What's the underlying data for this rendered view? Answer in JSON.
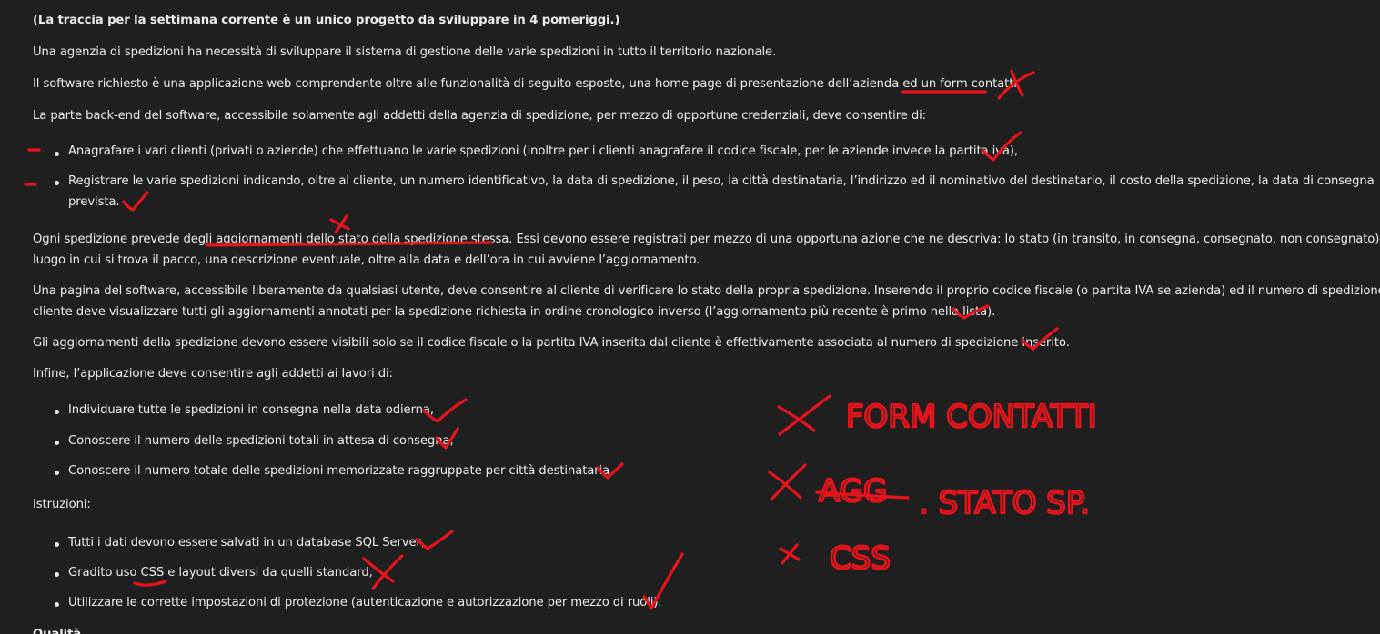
{
  "document": {
    "heading": "(La traccia per la settimana corrente è un unico progetto da sviluppare in 4 pomeriggi.)",
    "p1": "Una agenzia di spedizioni ha necessità di sviluppare il sistema di gestione delle varie spedizioni in tutto il territorio nazionale.",
    "p2": "Il software richiesto è una applicazione web comprendente oltre alle funzionalità di seguito esposte, una home page di presentazione dell’azienda ed un form contatti.",
    "p3": "La parte back-end del software, accessibile solamente agli addetti della agenzia di spedizione, per mezzo di opportune credenziali, deve consentire di:",
    "b1": "Anagrafare i vari clienti (privati o aziende) che effettuano le varie spedizioni (inoltre per i clienti anagrafare il codice fiscale, per le aziende invece la partita iva),",
    "b2_line1": "Registrare le varie spedizioni indicando, oltre al cliente, un numero identificativo, la data di spedizione, il peso, la città destinataria, l’indirizzo ed il nominativo del destinatario, il costo della spedizione, la data di consegna",
    "b2_line2": "prevista.",
    "p4_line1": "Ogni spedizione prevede degli aggiornamenti dello stato della spedizione stessa. Essi devono essere registrati per mezzo di una opportuna azione che ne descriva: lo stato (in transito, in consegna, consegnato, non consegnato), il",
    "p4_line2": "luogo in cui si trova il pacco, una descrizione eventuale, oltre alla data e dell’ora in cui avviene l’aggiornamento.",
    "p5_line1": "Una pagina del software, accessibile liberamente da qualsiasi utente, deve consentire al cliente di verificare lo stato della propria spedizione. Inserendo il proprio codice fiscale (o partita IVA se azienda) ed il numero di spedizione, il",
    "p5_line2": "cliente deve visualizzare tutti gli aggiornamenti annotati per la spedizione richiesta in ordine cronologico inverso (l’aggiornamento più recente è primo nella lista).",
    "p6": "Gli aggiornamenti della spedizione devono essere visibili solo se il codice fiscale o la partita IVA inserita dal cliente è effettivamente associata al numero di spedizione inserito.",
    "p7": "Infine, l’applicazione deve consentire agli addetti ai lavori di:",
    "b3": "Individuare tutte le spedizioni in consegna nella data odierna,",
    "b4": "Conoscere il numero delle spedizioni totali in attesa di consegna,",
    "b5": "Conoscere il numero totale delle spedizioni memorizzate raggruppate per città destinataria.",
    "p8": "Istruzioni:",
    "b6": "Tutti i dati devono essere salvati in un database SQL Server,",
    "b7": "Gradito uso CSS e layout diversi da quelli standard,",
    "b8": "Utilizzare le corrette impostazioni di protezione (autenticazione e autorizzazione per mezzo di ruoli).",
    "cutoff": "Qualità"
  },
  "annotations": {
    "note1": "FORM CONTATTI",
    "note2_struck": "AGG",
    "note2": ". STATO SP.",
    "note3": "CSS",
    "ink_color": "#e8141b"
  }
}
